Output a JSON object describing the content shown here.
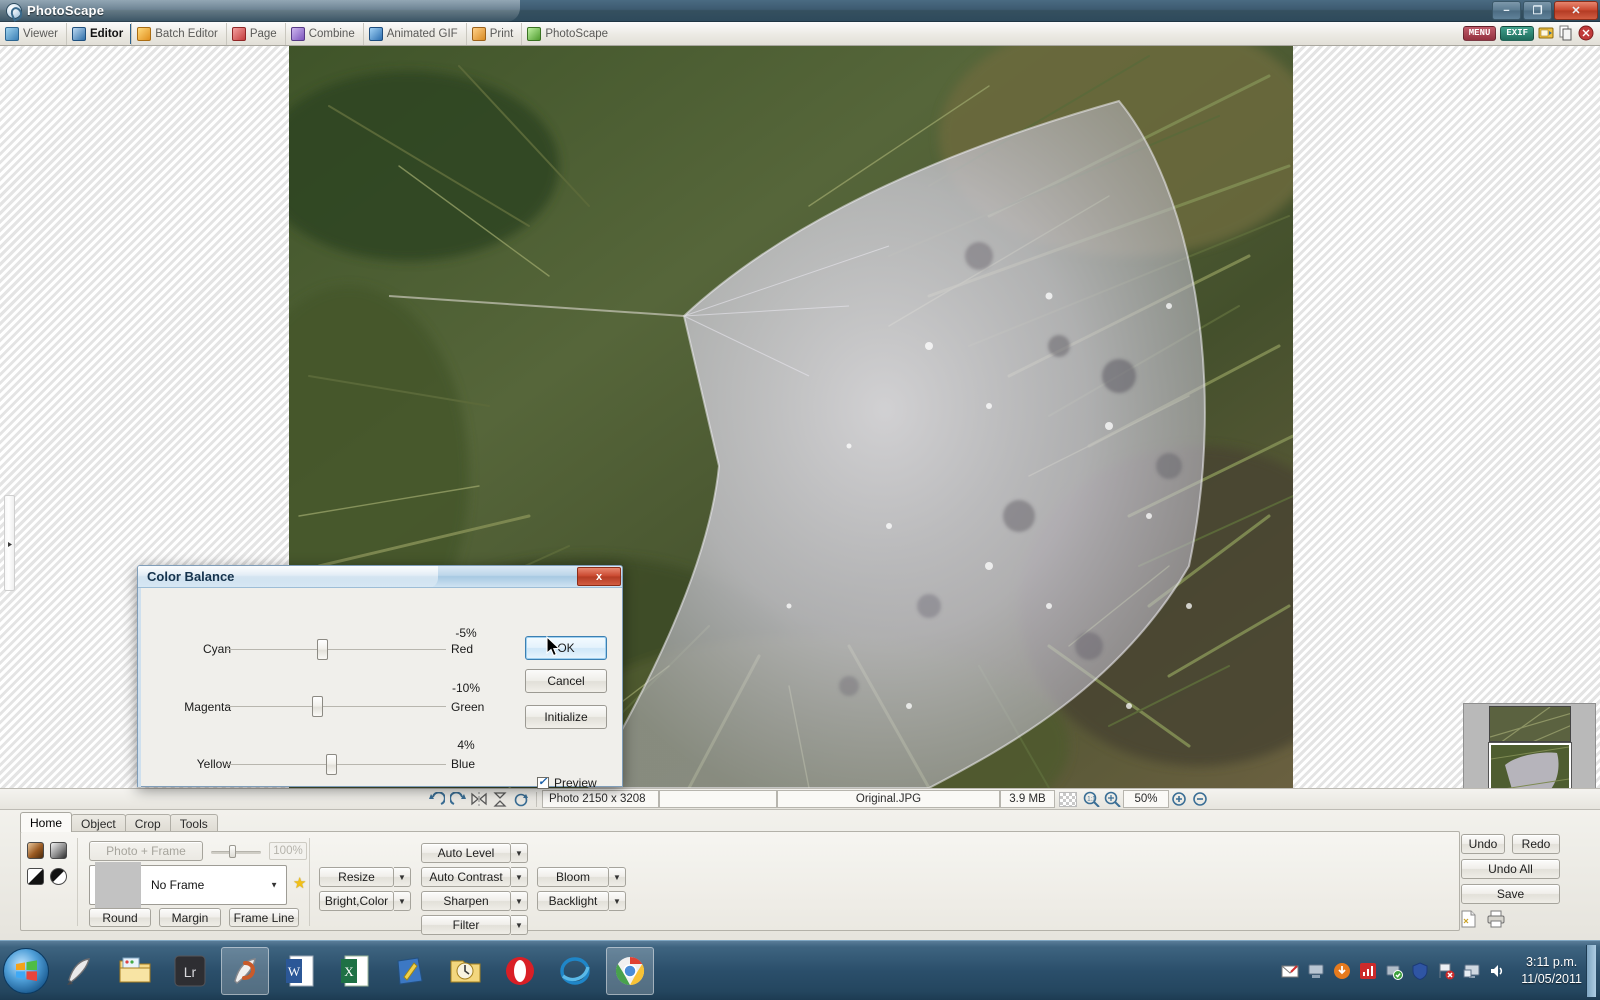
{
  "window": {
    "title": "PhotoScape",
    "minimize": "−",
    "maximize": "❐",
    "close": "✕"
  },
  "modebar": {
    "items": [
      {
        "label": "Viewer",
        "icon": "viewer-icon",
        "active": false
      },
      {
        "label": "Editor",
        "icon": "editor-icon",
        "active": true
      },
      {
        "label": "Batch Editor",
        "icon": "batch-editor-icon",
        "active": false
      },
      {
        "label": "Page",
        "icon": "page-icon",
        "active": false
      },
      {
        "label": "Combine",
        "icon": "combine-icon",
        "active": false
      },
      {
        "label": "Animated GIF",
        "icon": "animated-gif-icon",
        "active": false
      },
      {
        "label": "Print",
        "icon": "print-icon",
        "active": false
      },
      {
        "label": "PhotoScape",
        "icon": "photoscape-icon",
        "active": false
      }
    ],
    "right_badges": {
      "menu": "MENU",
      "exif": "EXIF"
    }
  },
  "statusbar": {
    "photo_size": "Photo 2150 x 3208",
    "blank": "",
    "filename": "Original.JPG",
    "filesize": "3.9 MB",
    "zoom": "50%"
  },
  "dialog": {
    "title": "Color Balance",
    "close": "x",
    "sliders": [
      {
        "left_label": "Cyan",
        "right_label": "Red",
        "value": "-5%",
        "percent": -5
      },
      {
        "left_label": "Magenta",
        "right_label": "Green",
        "value": "-10%",
        "percent": -10
      },
      {
        "left_label": "Yellow",
        "right_label": "Blue",
        "value": "4%",
        "percent": 4
      }
    ],
    "buttons": {
      "ok": "OK",
      "cancel": "Cancel",
      "initialize": "Initialize"
    },
    "preview_label": "Preview",
    "preview_checked": true
  },
  "toolpanel": {
    "tabs": [
      {
        "label": "Home",
        "active": true
      },
      {
        "label": "Object",
        "active": false
      },
      {
        "label": "Crop",
        "active": false
      },
      {
        "label": "Tools",
        "active": false
      }
    ],
    "swatches": [
      "sepia-swatch",
      "grayscale-swatch",
      "blackwhite-swatch",
      "negative-swatch"
    ],
    "photo_frame_button": "Photo + Frame",
    "opacity_value": "100%",
    "frame_select": "No Frame",
    "frame_buttons": [
      "Round",
      "Margin",
      "Frame Line"
    ],
    "edit_buttons": [
      {
        "label": "Resize",
        "dropdown": true
      },
      {
        "label": "Bright,Color",
        "dropdown": true
      },
      {
        "label": "Auto Level",
        "dropdown": true
      },
      {
        "label": "Auto Contrast",
        "dropdown": true
      },
      {
        "label": "Sharpen",
        "dropdown": true
      },
      {
        "label": "Filter",
        "dropdown": true
      },
      {
        "label": "Bloom",
        "dropdown": true
      },
      {
        "label": "Backlight",
        "dropdown": true
      }
    ],
    "right_buttons": {
      "undo": "Undo",
      "redo": "Redo",
      "undo_all": "Undo All",
      "save": "Save"
    }
  },
  "taskbar": {
    "start": "start-orb",
    "items": [
      "photoscape-quicklaunch-icon",
      "explorer-icon",
      "lightroom-icon",
      "photoscape-icon",
      "word-icon",
      "excel-icon",
      "publisher-icon",
      "outlook-icon",
      "opera-icon",
      "internet-explorer-icon",
      "chrome-icon"
    ],
    "tray_icons": [
      "mail-icon",
      "network-share-icon",
      "update-icon",
      "chart-icon",
      "security-icon",
      "shield-icon",
      "flag-error-icon",
      "display-icon",
      "volume-icon"
    ],
    "time": "3:11 p.m.",
    "date": "11/05/2011"
  },
  "colors": {
    "titlebar": "#35505f",
    "accent": "#3c7fb1",
    "close_red": "#c9482f",
    "taskbar": "#2b4f6b"
  }
}
